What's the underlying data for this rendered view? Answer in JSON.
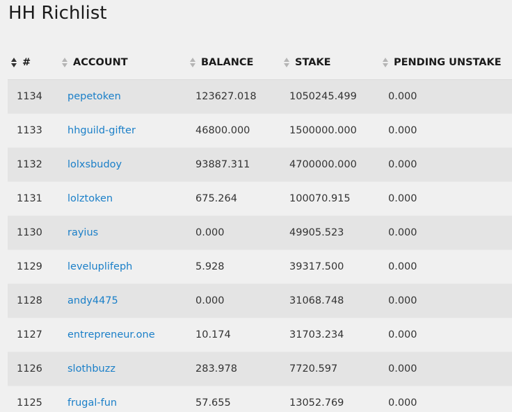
{
  "page": {
    "title": "HH Richlist"
  },
  "table": {
    "columns": [
      {
        "label": "#",
        "active": true
      },
      {
        "label": "ACCOUNT",
        "active": false
      },
      {
        "label": "BALANCE",
        "active": false
      },
      {
        "label": "STAKE",
        "active": false
      },
      {
        "label": "PENDING UNSTAKE",
        "active": false
      }
    ],
    "rows": [
      {
        "rank": "1134",
        "account": "pepetoken",
        "balance": "123627.018",
        "stake": "1050245.499",
        "pending": "0.000"
      },
      {
        "rank": "1133",
        "account": "hhguild-gifter",
        "balance": "46800.000",
        "stake": "1500000.000",
        "pending": "0.000"
      },
      {
        "rank": "1132",
        "account": "lolxsbudoy",
        "balance": "93887.311",
        "stake": "4700000.000",
        "pending": "0.000"
      },
      {
        "rank": "1131",
        "account": "lolztoken",
        "balance": "675.264",
        "stake": "100070.915",
        "pending": "0.000"
      },
      {
        "rank": "1130",
        "account": "rayius",
        "balance": "0.000",
        "stake": "49905.523",
        "pending": "0.000"
      },
      {
        "rank": "1129",
        "account": "leveluplifeph",
        "balance": "5.928",
        "stake": "39317.500",
        "pending": "0.000"
      },
      {
        "rank": "1128",
        "account": "andy4475",
        "balance": "0.000",
        "stake": "31068.748",
        "pending": "0.000"
      },
      {
        "rank": "1127",
        "account": "entrepreneur.one",
        "balance": "10.174",
        "stake": "31703.234",
        "pending": "0.000"
      },
      {
        "rank": "1126",
        "account": "slothbuzz",
        "balance": "283.978",
        "stake": "7720.597",
        "pending": "0.000"
      },
      {
        "rank": "1125",
        "account": "frugal-fun",
        "balance": "57.655",
        "stake": "13052.769",
        "pending": "0.000"
      }
    ]
  },
  "colors": {
    "link": "#1a7fc8",
    "row_stripe": "#e4e4e4",
    "background": "#f0f0f0"
  }
}
